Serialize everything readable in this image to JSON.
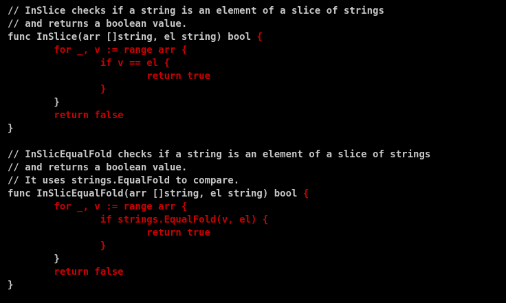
{
  "theme": {
    "background": "#000000",
    "default_color": "#c7c7c7",
    "keyword_color": "#cc0000"
  },
  "lines": [
    [
      {
        "t": "// InSlice checks if a string is an element of a slice of strings",
        "c": "plain"
      }
    ],
    [
      {
        "t": "// and returns a boolean value.",
        "c": "plain"
      }
    ],
    [
      {
        "t": "func InSlice(arr []string, el string) bool ",
        "c": "plain"
      },
      {
        "t": "{",
        "c": "kw"
      }
    ],
    [
      {
        "t": "        for _, v := range arr {",
        "c": "kw"
      }
    ],
    [
      {
        "t": "                if v == el {",
        "c": "kw"
      }
    ],
    [
      {
        "t": "                        return true",
        "c": "kw"
      }
    ],
    [
      {
        "t": "                }",
        "c": "kw"
      }
    ],
    [
      {
        "t": "        }",
        "c": "plain"
      }
    ],
    [
      {
        "t": "        return false",
        "c": "kw"
      }
    ],
    [
      {
        "t": "}",
        "c": "plain"
      }
    ],
    [],
    [
      {
        "t": "// InSlicEqualFold checks if a string is an element of a slice of strings",
        "c": "plain"
      }
    ],
    [
      {
        "t": "// and returns a boolean value.",
        "c": "plain"
      }
    ],
    [
      {
        "t": "// It uses strings.EqualFold to compare.",
        "c": "plain"
      }
    ],
    [
      {
        "t": "func InSlicEqualFold(arr []string, el string) bool ",
        "c": "plain"
      },
      {
        "t": "{",
        "c": "kw"
      }
    ],
    [
      {
        "t": "        for _, v := range arr {",
        "c": "kw"
      }
    ],
    [
      {
        "t": "                if strings.EqualFold(v, el) {",
        "c": "kw"
      }
    ],
    [
      {
        "t": "                        return true",
        "c": "kw"
      }
    ],
    [
      {
        "t": "                }",
        "c": "kw"
      }
    ],
    [
      {
        "t": "        }",
        "c": "plain"
      }
    ],
    [
      {
        "t": "        return false",
        "c": "kw"
      }
    ],
    [
      {
        "t": "}",
        "c": "plain"
      }
    ]
  ]
}
